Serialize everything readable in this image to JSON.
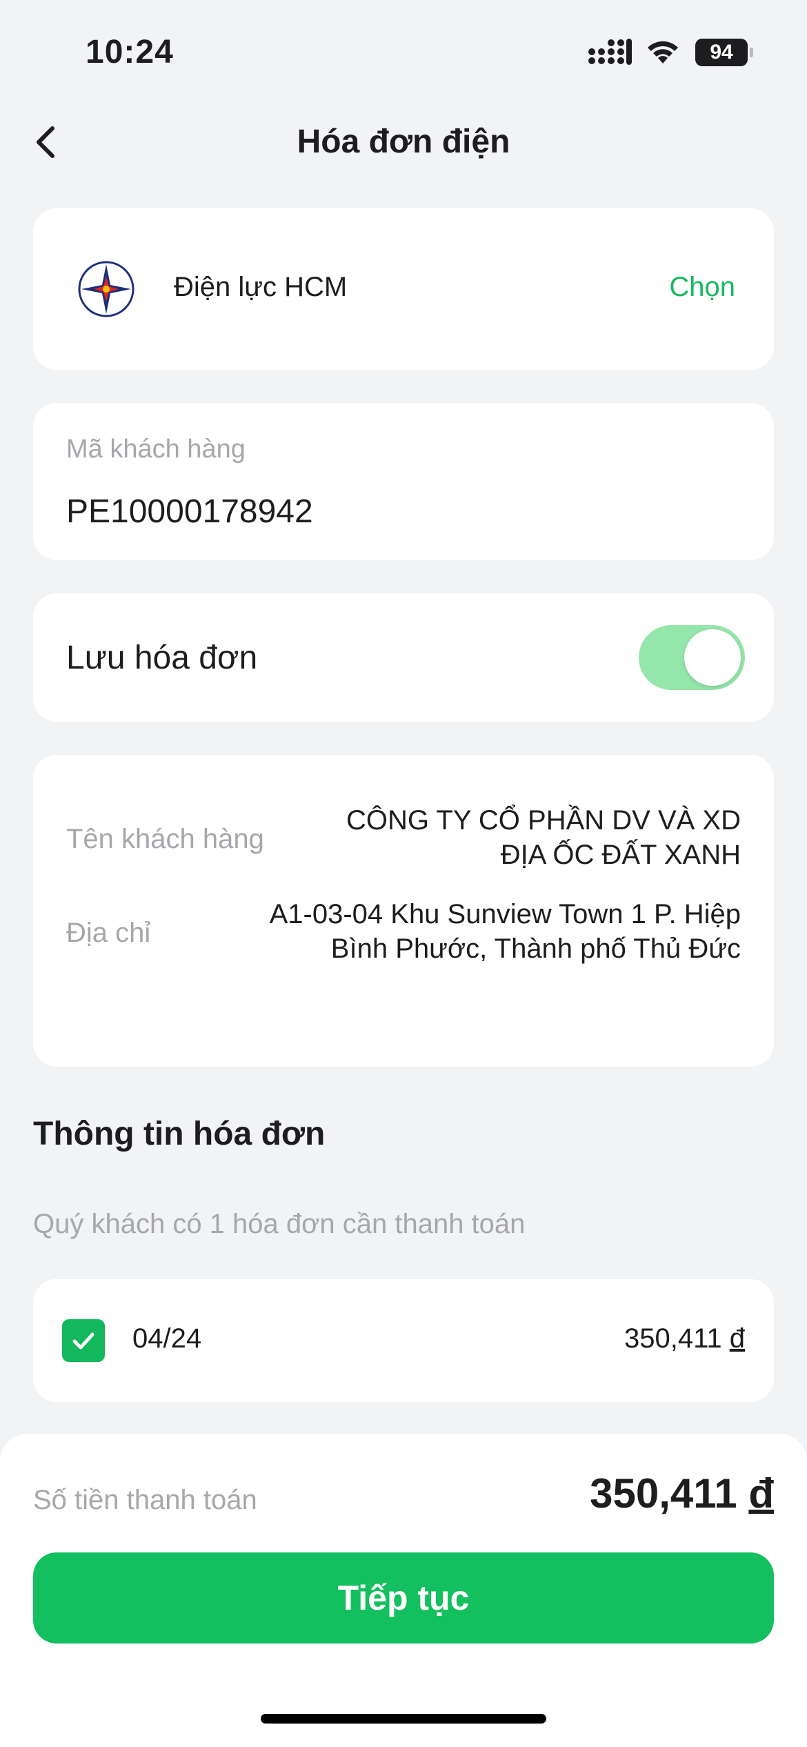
{
  "status_bar": {
    "time": "10:24",
    "battery": "94"
  },
  "header": {
    "title": "Hóa đơn điện"
  },
  "provider": {
    "name": "Điện lực HCM",
    "choose_label": "Chọn"
  },
  "customer_code": {
    "label": "Mã khách hàng",
    "value": "PE10000178942"
  },
  "save_bill": {
    "label": "Lưu hóa đơn",
    "enabled": true
  },
  "customer_info": {
    "name_label": "Tên khách hàng",
    "name_value_line1": "CÔNG TY CỔ PHẦN DV VÀ XD",
    "name_value_line2": "ĐỊA ỐC ĐẤT XANH",
    "address_label": "Địa chỉ",
    "address_value_line1": "A1-03-04 Khu Sunview Town 1 P. Hiệp",
    "address_value_line2": "Bình Phước, Thành phố Thủ Đức"
  },
  "bill_section": {
    "title": "Thông tin hóa đơn",
    "subtitle": "Quý khách có 1 hóa đơn cần thanh toán",
    "bills": [
      {
        "period": "04/24",
        "amount": "350,411",
        "currency": "đ",
        "checked": true
      }
    ]
  },
  "payment": {
    "label": "Số tiền thanh toán",
    "amount": "350,411",
    "currency": "đ",
    "continue_label": "Tiếp tục"
  },
  "colors": {
    "accent": "#13bf5e",
    "toggle_on": "#95e6ab",
    "muted_text": "#a6a7ab",
    "background": "#f2f3f5"
  }
}
